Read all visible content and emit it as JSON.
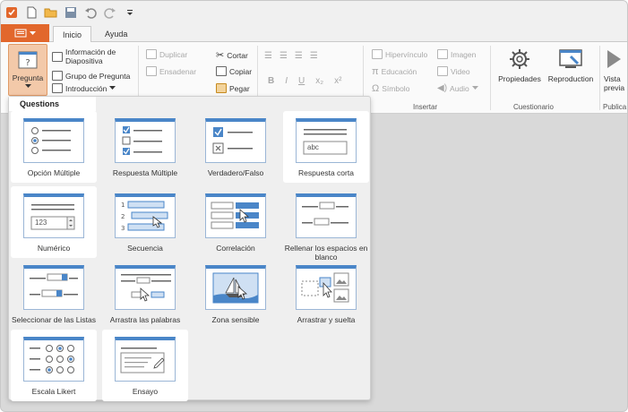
{
  "ribbon": {
    "tabs": [
      "Inicio",
      "Ayuda"
    ],
    "pregunta": "Pregunta",
    "slide_group": [
      "Información de Diapositiva",
      "Grupo de Pregunta",
      "Introducción"
    ],
    "clipboard": {
      "duplicar": "Duplicar",
      "ensadenar": "Ensadenar",
      "cortar": "Cortar",
      "copiar": "Copiar",
      "pegar": "Pegar"
    },
    "insert": {
      "hipervinculo": "Hipervínculo",
      "imagen": "Imagen",
      "educacion": "Educación",
      "video": "Video",
      "simbolo": "Símbolo",
      "audio": "Audio"
    },
    "quiz": {
      "propiedades": "Propiedades",
      "reproduccion": "Reproduction",
      "vista": "Vista previa",
      "publica": "Publica"
    },
    "group_labels": {
      "insertar": "Insertar",
      "cuestionario": "Cuestionario"
    }
  },
  "panel": {
    "header": "Questions",
    "items": [
      {
        "label": "Opción Múltiple",
        "icon": "multiple-choice-icon"
      },
      {
        "label": "Respuesta Múltiple",
        "icon": "multiple-response-icon"
      },
      {
        "label": "Verdadero/Falso",
        "icon": "true-false-icon"
      },
      {
        "label": "Respuesta corta",
        "icon": "short-answer-icon"
      },
      {
        "label": "Numérico",
        "icon": "numeric-icon"
      },
      {
        "label": "Secuencia",
        "icon": "sequence-icon"
      },
      {
        "label": "Correlación",
        "icon": "matching-icon"
      },
      {
        "label": "Rellenar los espacios en blanco",
        "icon": "fill-blanks-icon"
      },
      {
        "label": "Seleccionar de las Listas",
        "icon": "select-lists-icon"
      },
      {
        "label": "Arrastra las palabras",
        "icon": "drag-words-icon"
      },
      {
        "label": "Zona sensible",
        "icon": "hotspot-icon"
      },
      {
        "label": "Arrastrar y suelta",
        "icon": "drag-drop-icon"
      },
      {
        "label": "Escala Likert",
        "icon": "likert-icon"
      },
      {
        "label": "Ensayo",
        "icon": "essay-icon"
      }
    ],
    "short_answer_sample": "abc",
    "numeric_sample": "123"
  },
  "colors": {
    "accent": "#e2672c",
    "thumb_blue": "#4a86c8"
  }
}
